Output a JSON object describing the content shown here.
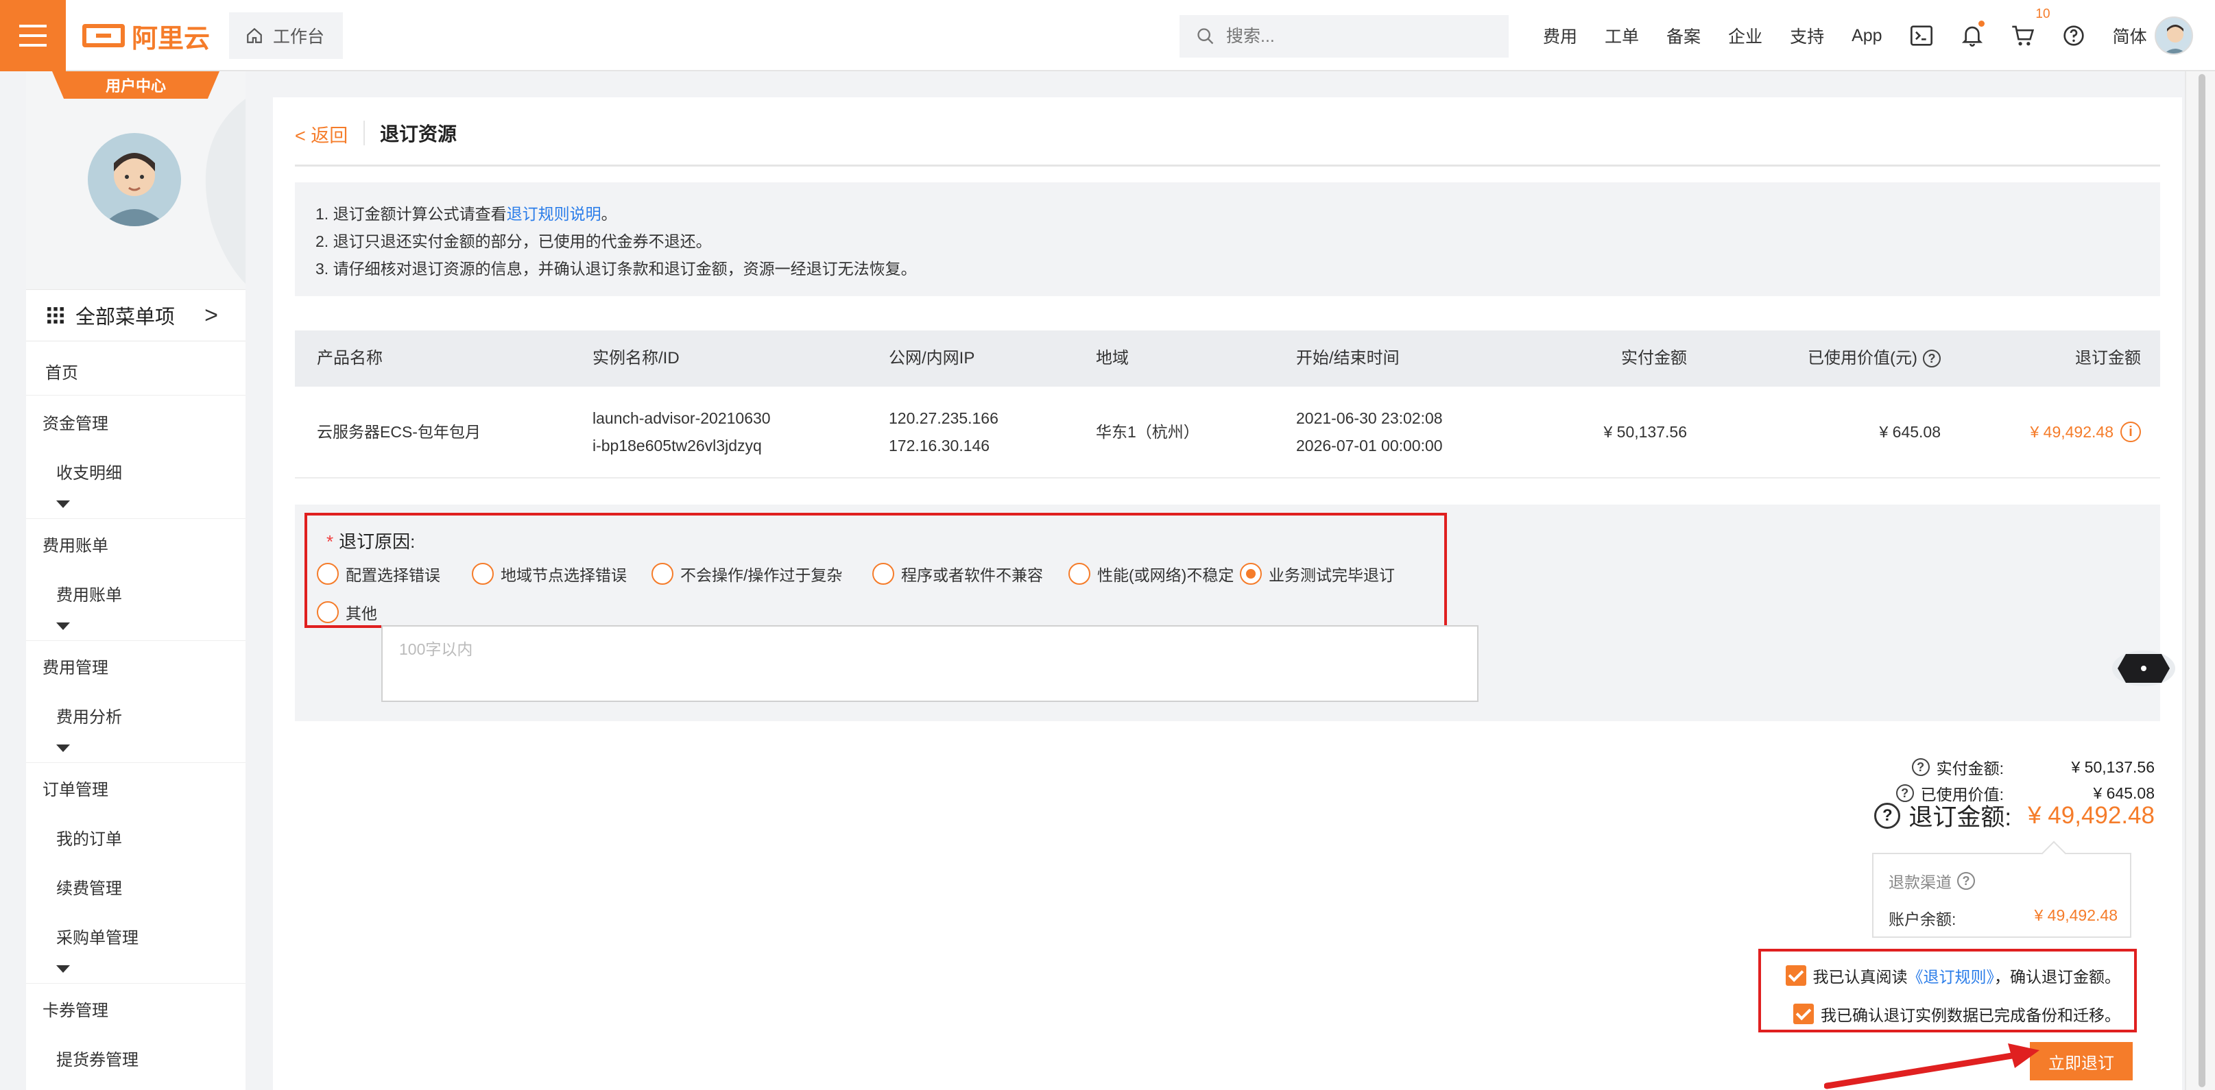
{
  "header": {
    "logo_text": "阿里云",
    "workbench_label": "工作台",
    "search_placeholder": "搜索...",
    "nav": [
      "费用",
      "工单",
      "备案",
      "企业",
      "支持",
      "App"
    ],
    "cart_count": "10",
    "language": "简体",
    "icons": [
      "terminal-icon",
      "bell-icon",
      "cart-icon",
      "help-icon"
    ]
  },
  "sidebar": {
    "user_center_tag": "用户中心",
    "username": "",
    "all_menu_label": "全部菜单项",
    "items": [
      {
        "label": "首页",
        "level": 0
      },
      {
        "label": "资金管理",
        "level": 0
      },
      {
        "label": "收支明细",
        "level": 1
      },
      {
        "label": "费用账单",
        "level": 0
      },
      {
        "label": "费用账单",
        "level": 1
      },
      {
        "label": "费用管理",
        "level": 0
      },
      {
        "label": "费用分析",
        "level": 1
      },
      {
        "label": "订单管理",
        "level": 0
      },
      {
        "label": "我的订单",
        "level": 1
      },
      {
        "label": "续费管理",
        "level": 1
      },
      {
        "label": "采购单管理",
        "level": 1
      },
      {
        "label": "卡券管理",
        "level": 0
      },
      {
        "label": "提货券管理",
        "level": 1
      }
    ]
  },
  "page": {
    "back_label": "< 返回",
    "title": "退订资源",
    "notice": {
      "line1_prefix": "1. 退订金额计算公式请查看",
      "line1_link": "退订规则说明",
      "line1_suffix": "。",
      "line2": "2. 退订只退还实付金额的部分，已使用的代金券不退还。",
      "line3": "3. 请仔细核对退订资源的信息，并确认退订条款和退订金额，资源一经退订无法恢复。"
    },
    "table": {
      "headers": {
        "product": "产品名称",
        "instance": "实例名称/ID",
        "ip": "公网/内网IP",
        "region": "地域",
        "time": "开始/结束时间",
        "paid": "实付金额",
        "used": "已使用价值(元)",
        "refund": "退订金额"
      },
      "row": {
        "product": "云服务器ECS-包年包月",
        "instance_name": "launch-advisor-20210630",
        "instance_id": "i-bp18e605tw26vl3jdzyq",
        "public_ip": "120.27.235.166",
        "private_ip": "172.16.30.146",
        "region": "华东1（杭州）",
        "start_time": "2021-06-30 23:02:08",
        "end_time": "2026-07-01 00:00:00",
        "paid": "¥ 50,137.56",
        "used": "¥ 645.08",
        "refund": "¥ 49,492.48"
      }
    },
    "reason": {
      "label": "退订原因:",
      "options": [
        {
          "label": "配置选择错误",
          "checked": false
        },
        {
          "label": "地域节点选择错误",
          "checked": false
        },
        {
          "label": "不会操作/操作过于复杂",
          "checked": false
        },
        {
          "label": "程序或者软件不兼容",
          "checked": false
        },
        {
          "label": "性能(或网络)不稳定",
          "checked": false
        },
        {
          "label": "业务测试完毕退订",
          "checked": true
        },
        {
          "label": "其他",
          "checked": false
        }
      ],
      "text_placeholder": "100字以内"
    },
    "summary": {
      "paid_label": "实付金额:",
      "paid_value": "¥ 50,137.56",
      "used_label": "已使用价值:",
      "used_value": "¥ 645.08",
      "refund_label": "退订金额:",
      "refund_value": "¥ 49,492.48",
      "channel_label": "退款渠道",
      "balance_label": "账户余额:",
      "balance_value": "¥ 49,492.48"
    },
    "confirm": {
      "line1_prefix": "我已认真阅读",
      "line1_link": "《退订规则》",
      "line1_suffix": "，确认退订金额。",
      "line2": "我已确认退订实例数据已完成备份和迁移。"
    },
    "submit_label": "立即退订"
  },
  "colors": {
    "accent": "#f57c2a",
    "link": "#2b7de9",
    "highlight_border": "#e02020"
  }
}
